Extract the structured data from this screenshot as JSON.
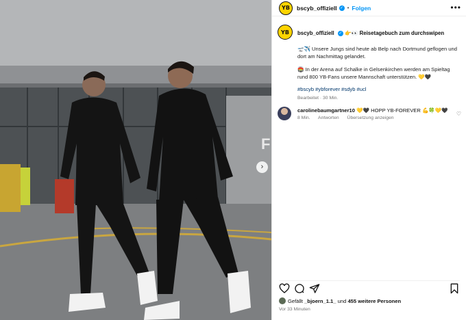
{
  "post": {
    "username": "bscyb_offiziell",
    "follow_label": "Folgen",
    "more_label": "•••",
    "avatar_text": "YB"
  },
  "caption": {
    "title_emoji": "👉👀",
    "title": "Reisetagebuch zum durchswipen",
    "line1": "🛫✈️ Unsere Jungs sind heute ab Belp nach Dortmund geflogen und dort am Nachmittag gelandet.",
    "line2": "🏟️ In der Arena auf Schalke in Gelsenkirchen werden am Spieltag rund 800 YB-Fans unsere Mannschaft unterstützen. 💛🖤",
    "hashtags": "#bscyb #ybforever #sdyb #ucl",
    "meta": "Bearbeitet · 30 Min."
  },
  "comment": {
    "username": "carolinebaumgartner10",
    "text": "💛🖤 HOPP YB-FOREVER 💪🍀💛🖤",
    "time": "8 Min.",
    "reply": "Antworten",
    "translate": "Übersetzung anzeigen"
  },
  "likes": {
    "prefix": "Gefällt",
    "user": "_bjoern_1.1_",
    "middle": "und",
    "others": "455 weitere Personen"
  },
  "posted_ago": "Vor 33 Minuten",
  "icons": {
    "heart": "heart-icon",
    "comment": "comment-icon",
    "share": "share-icon",
    "save": "bookmark-icon",
    "next": "chevron-right-icon"
  },
  "colors": {
    "accent": "#0095f6",
    "brand_yellow": "#ffd400",
    "hashtag": "#00376b",
    "muted": "#737373"
  },
  "photo": {
    "building_letter": "F"
  }
}
